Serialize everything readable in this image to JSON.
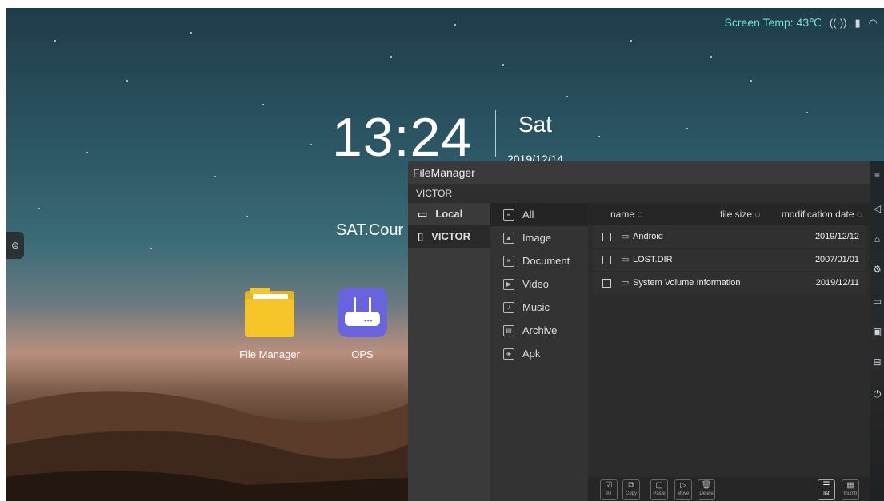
{
  "status": {
    "temp": "Screen Temp: 43℃"
  },
  "clock": {
    "time": "13:24",
    "day": "Sat",
    "date": "2019/12/14"
  },
  "school": "SAT.Cour",
  "apps": [
    {
      "label": "File Manager"
    },
    {
      "label": "OPS"
    }
  ],
  "filemanager": {
    "title": "FileManager",
    "path": "VICTOR",
    "devices": [
      {
        "label": "Local",
        "icon": "monitor-icon"
      },
      {
        "label": "VICTOR",
        "icon": "usb-icon"
      }
    ],
    "categories": [
      {
        "label": "All"
      },
      {
        "label": "Image"
      },
      {
        "label": "Document"
      },
      {
        "label": "Video"
      },
      {
        "label": "Music"
      },
      {
        "label": "Archive"
      },
      {
        "label": "Apk"
      }
    ],
    "columns": {
      "name": "name ◌",
      "size": "file size ◌",
      "date": "modification date ◌"
    },
    "files": [
      {
        "name": "Android",
        "date": "2019/12/12"
      },
      {
        "name": "LOST.DIR",
        "date": "2007/01/01"
      },
      {
        "name": "System Volume Information",
        "date": "2019/12/11"
      }
    ],
    "toolbar": {
      "all": "All",
      "copy": "Copy",
      "paste": "Paste",
      "move": "Move",
      "delete": "Delete",
      "list": "list",
      "thumb": "thumb"
    }
  },
  "colors": {
    "accent": "#4fb8aa",
    "temp": "#6fe0d8"
  }
}
